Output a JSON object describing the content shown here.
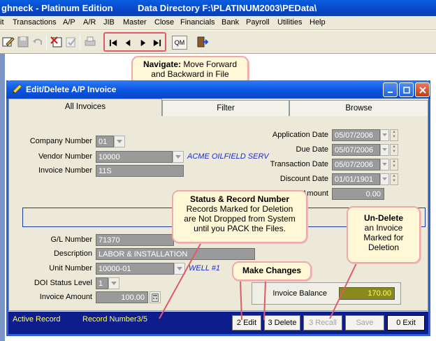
{
  "app": {
    "title": "ghneck - Platinum Edition",
    "data_directory": "Data Directory  F:\\PLATINUM2003\\PEData\\"
  },
  "menu": [
    "it",
    "Transactions",
    "A/P",
    "A/R",
    "JIB",
    "Master",
    "Close",
    "Financials",
    "Bank",
    "Payroll",
    "Utilities",
    "Help"
  ],
  "toolbar": {
    "qm_label": "QM"
  },
  "callouts": {
    "navigate_title": "Navigate:",
    "navigate_text_1": " Move Forward",
    "navigate_text_2": "and Backward in File",
    "status_title": "Status & Record Number",
    "status_line1": "Records Marked for Deletion",
    "status_line2": "are Not Dropped from System",
    "status_line3": "until you PACK the Files.",
    "undelete_title": "Un-Delete",
    "undelete_line1": "an Invoice",
    "undelete_line2": "Marked for",
    "undelete_line3": "Deletion",
    "changes_title": "Make Changes"
  },
  "window": {
    "title": "Edit/Delete A/P Invoice",
    "tabs": [
      "All Invoices",
      "Filter",
      "Browse"
    ]
  },
  "form": {
    "company_number_label": "Company Number",
    "company_number": "01",
    "vendor_number_label": "Vendor Number",
    "vendor_number": "10000",
    "vendor_name": "ACME OILFIELD SERV",
    "invoice_number_label": "Invoice Number",
    "invoice_number": "11S",
    "application_date_label": "Application Date",
    "application_date": "05/07/2006",
    "due_date_label": "Due Date",
    "due_date": "05/07/2006",
    "transaction_date_label": "Transaction Date",
    "transaction_date": "05/07/2006",
    "discount_date_label": "Discount Date",
    "discount_date": "01/01/1901",
    "amount_label": "Amount",
    "amount": "0.00",
    "gl_number_label": "G/L Number",
    "gl_number": "71370",
    "description_label": "Description",
    "description": "LABOR & INSTALLATION",
    "unit_number_label": "Unit Number",
    "unit_number": "10000-01",
    "unit_name": "WELL #1",
    "doi_status_label": "DOI Status Level",
    "doi_status": "1",
    "invoice_amount_label": "Invoice Amount",
    "invoice_amount": "100.00",
    "invoice_balance_label": "Invoice Balance",
    "invoice_balance": "170.00"
  },
  "statusbar": {
    "active": "Active Record",
    "record": "Record Number3/5",
    "buttons": {
      "edit": "2 Edit",
      "delete": "3 Delete",
      "recall": "3 Recall",
      "save": "Save",
      "exit": "0 Exit"
    }
  },
  "colors": {
    "title_blue": "#0548c8",
    "callout_fill": "#fff7d6",
    "callout_border": "#f2a9a9",
    "field_gray": "#9a9a9a",
    "balance_olive": "#8a8a1c",
    "statusbar_navy": "#0d1d8c",
    "status_text_yellow": "#ffff66"
  }
}
